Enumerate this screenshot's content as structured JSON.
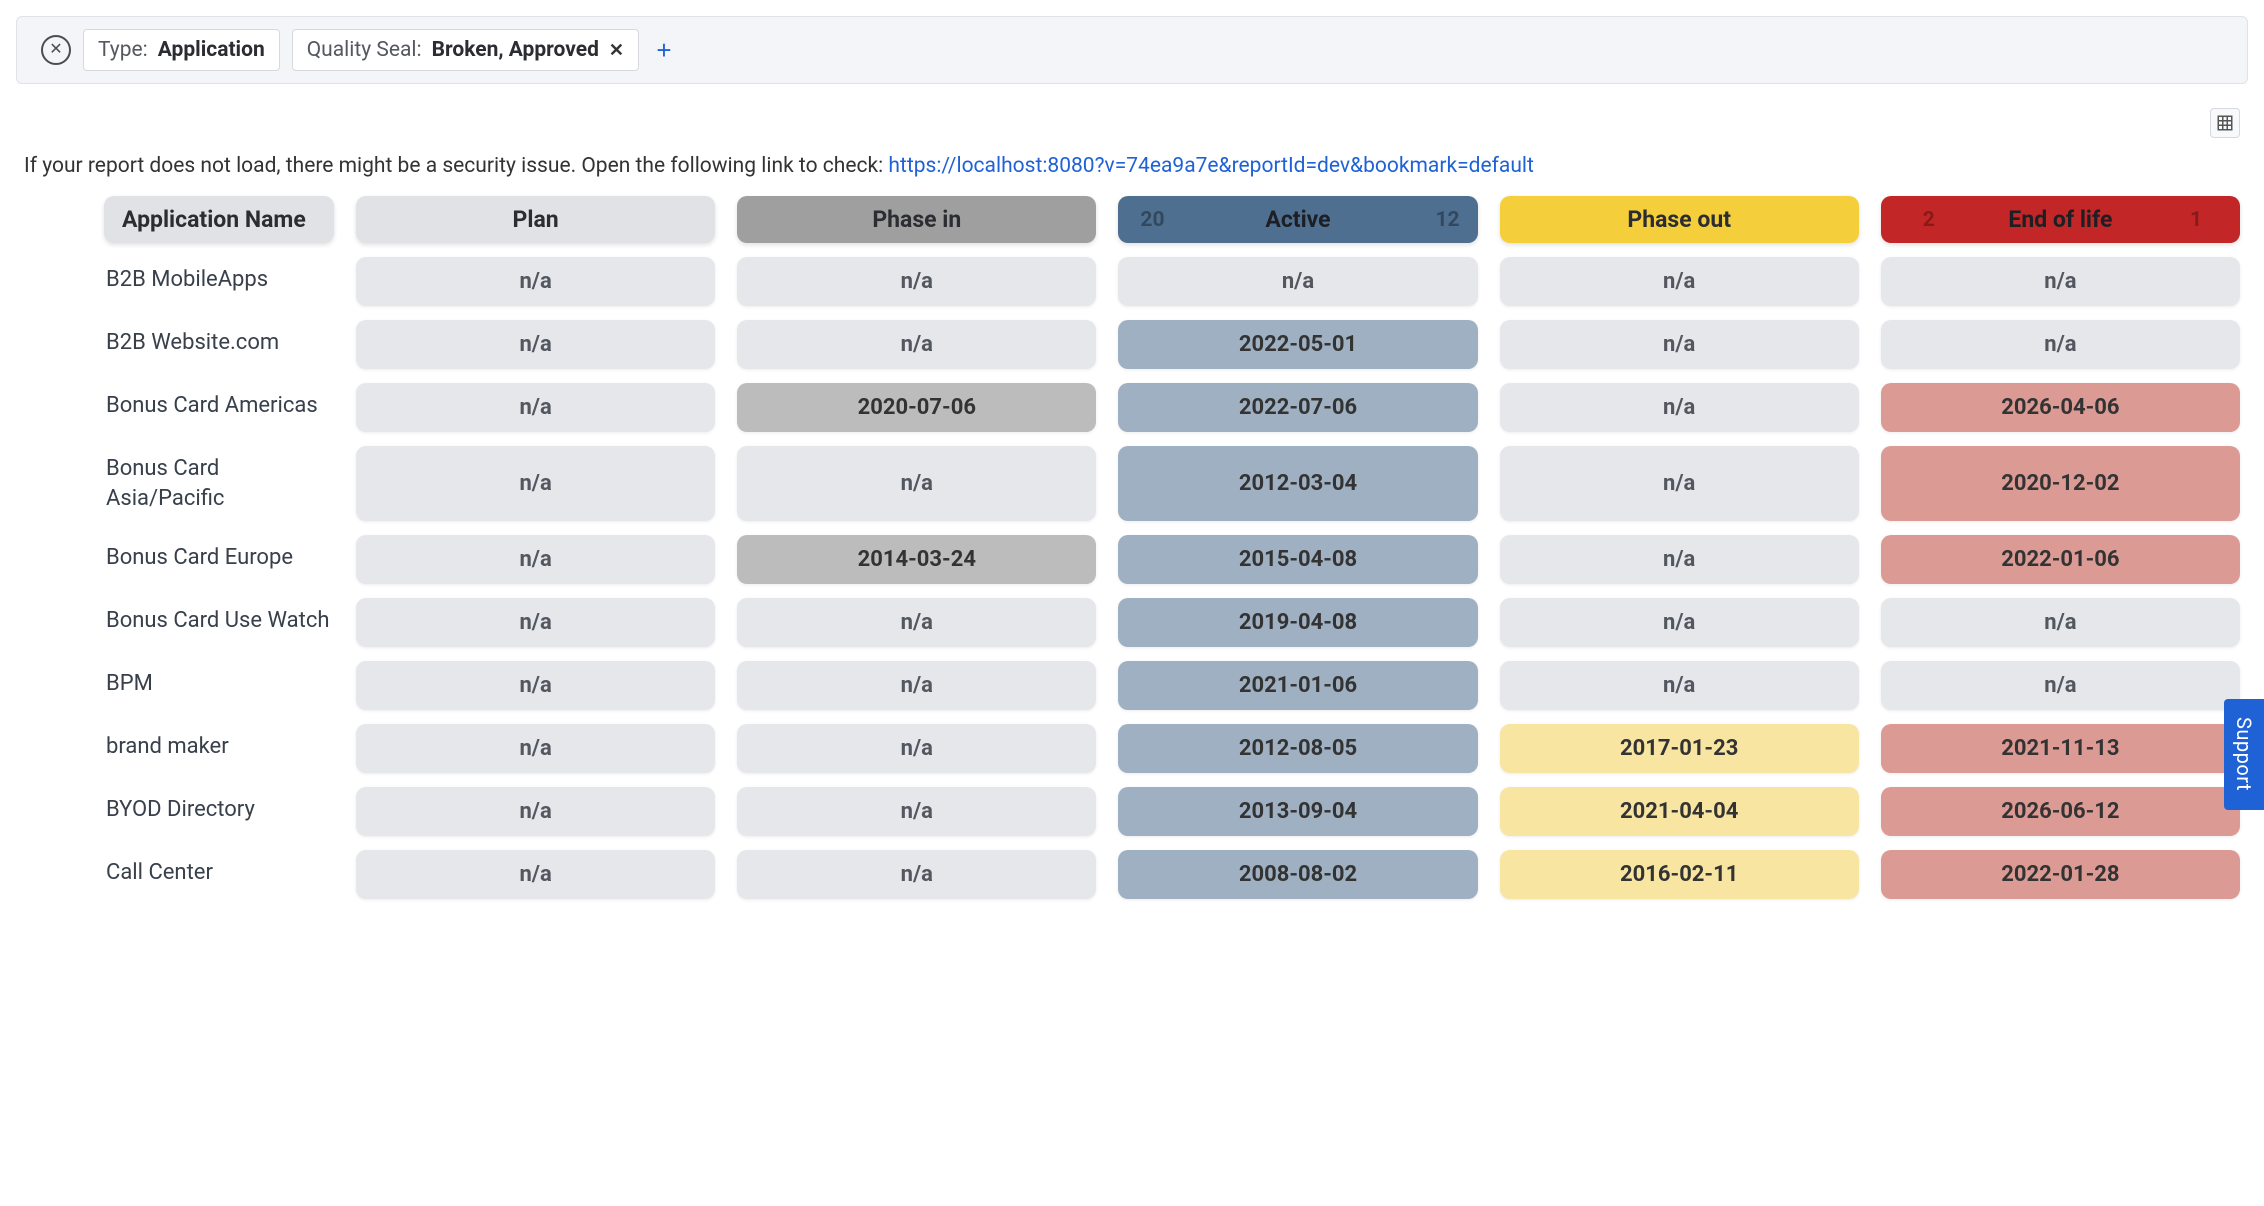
{
  "filters": {
    "type_label": "Type:",
    "type_value": "Application",
    "quality_label": "Quality Seal:",
    "quality_value": "Broken, Approved"
  },
  "info": {
    "text_prefix": "If your report does not load, there might be a security issue. Open the following link to check: ",
    "link_text": "https://localhost:8080?v=74ea9a7e&reportId=dev&bookmark=default"
  },
  "headers": {
    "name": "Application Name",
    "plan": "Plan",
    "phase_in": "Phase in",
    "active": "Active",
    "active_ghost_left": "20",
    "active_ghost_right": "12",
    "phase_out": "Phase out",
    "eol": "End of life",
    "eol_ghost_left": "2",
    "eol_ghost_right": "1"
  },
  "rows": [
    {
      "name": "B2B MobileApps",
      "plan": "n/a",
      "phase_in": "n/a",
      "active": "n/a",
      "phase_out": "n/a",
      "eol": "n/a"
    },
    {
      "name": "B2B Website.com",
      "plan": "n/a",
      "phase_in": "n/a",
      "active": "2022-05-01",
      "phase_out": "n/a",
      "eol": "n/a"
    },
    {
      "name": "Bonus Card Americas",
      "plan": "n/a",
      "phase_in": "2020-07-06",
      "active": "2022-07-06",
      "phase_out": "n/a",
      "eol": "2026-04-06"
    },
    {
      "name": "Bonus Card Asia/Pacific",
      "plan": "n/a",
      "phase_in": "n/a",
      "active": "2012-03-04",
      "phase_out": "n/a",
      "eol": "2020-12-02"
    },
    {
      "name": "Bonus Card Europe",
      "plan": "n/a",
      "phase_in": "2014-03-24",
      "active": "2015-04-08",
      "phase_out": "n/a",
      "eol": "2022-01-06"
    },
    {
      "name": "Bonus Card Use Watch",
      "plan": "n/a",
      "phase_in": "n/a",
      "active": "2019-04-08",
      "phase_out": "n/a",
      "eol": "n/a"
    },
    {
      "name": "BPM",
      "plan": "n/a",
      "phase_in": "n/a",
      "active": "2021-01-06",
      "phase_out": "n/a",
      "eol": "n/a"
    },
    {
      "name": "brand maker",
      "plan": "n/a",
      "phase_in": "n/a",
      "active": "2012-08-05",
      "phase_out": "2017-01-23",
      "eol": "2021-11-13"
    },
    {
      "name": "BYOD Directory",
      "plan": "n/a",
      "phase_in": "n/a",
      "active": "2013-09-04",
      "phase_out": "2021-04-04",
      "eol": "2026-06-12"
    },
    {
      "name": "Call Center",
      "plan": "n/a",
      "phase_in": "n/a",
      "active": "2008-08-02",
      "phase_out": "2016-02-11",
      "eol": "2022-01-28"
    }
  ],
  "support_label": "Support"
}
